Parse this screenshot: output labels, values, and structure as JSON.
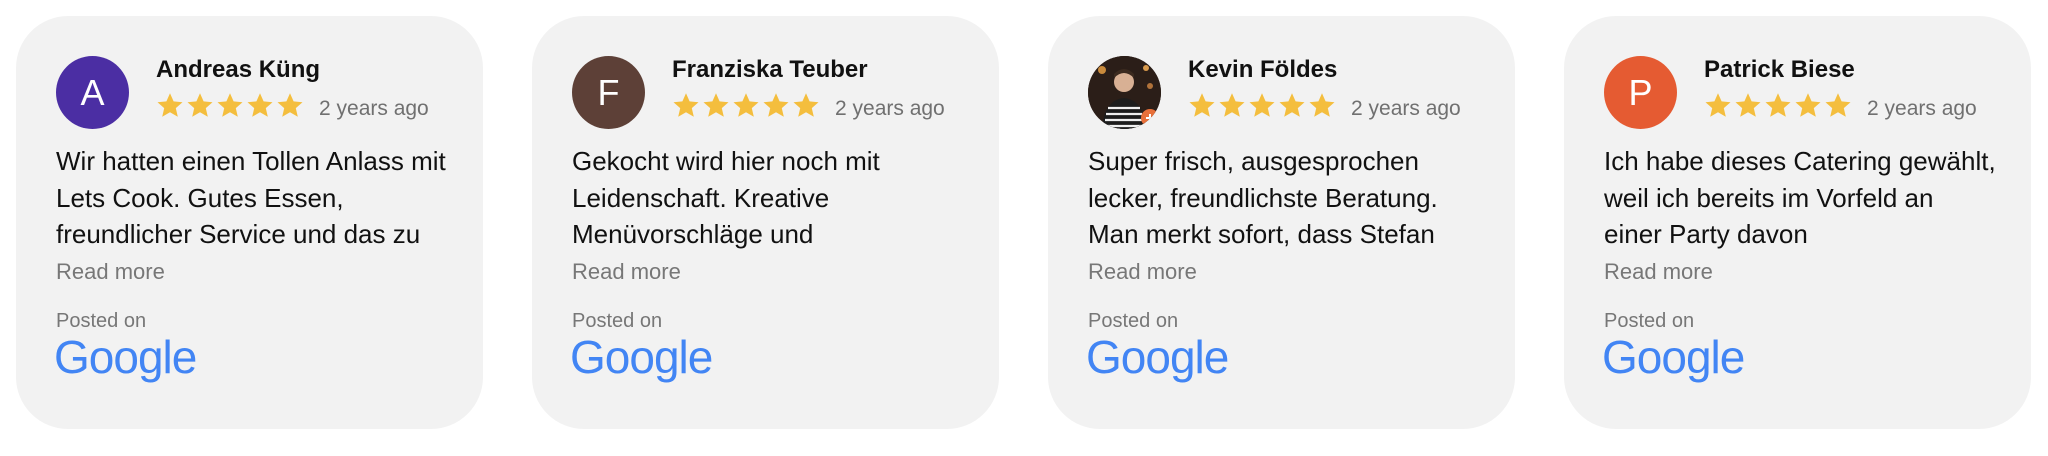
{
  "colors": {
    "card_bg": "#f2f2f2",
    "star": "#f4be3e",
    "google_blue": "#4285f4",
    "muted_text": "#777777"
  },
  "reviews": [
    {
      "avatar_letter": "A",
      "avatar_color": "#4b2ea3",
      "name": "Andreas Küng",
      "rating": 5,
      "age": "2 years ago",
      "text": "Wir hatten einen Tollen Anlass mit Lets Cook. Gutes Essen, freundlicher Service und das zu",
      "read_more": "Read more",
      "posted_on": "Posted on",
      "source": "Google"
    },
    {
      "avatar_letter": "F",
      "avatar_color": "#5d4037",
      "name": "Franziska Teuber",
      "rating": 5,
      "age": "2 years ago",
      "text": "Gekocht wird hier noch mit Leidenschaft. Kreative Menüvorschläge und",
      "read_more": "Read more",
      "posted_on": "Posted on",
      "source": "Google"
    },
    {
      "avatar_letter": "",
      "avatar_color": "#3a2a22",
      "avatar_icon": "profile-photo",
      "name": "Kevin Földes",
      "rating": 5,
      "age": "2 years ago",
      "text": "Super frisch, ausgesprochen lecker, freundlichste Beratung. Man merkt sofort, dass Stefan",
      "read_more": "Read more",
      "posted_on": "Posted on",
      "source": "Google"
    },
    {
      "avatar_letter": "P",
      "avatar_color": "#e55b32",
      "name": "Patrick Biese",
      "rating": 5,
      "age": "2 years ago",
      "text": "Ich habe dieses Catering gewählt, weil ich bereits im Vorfeld an einer Party davon",
      "read_more": "Read more",
      "posted_on": "Posted on",
      "source": "Google"
    }
  ]
}
